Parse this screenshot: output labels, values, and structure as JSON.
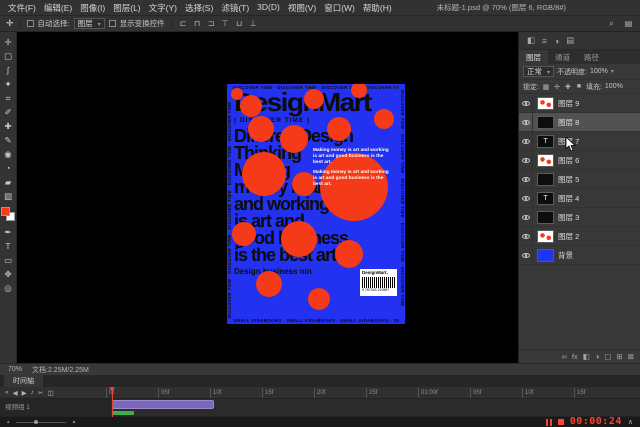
{
  "app": {
    "menu": [
      "文件(F)",
      "编辑(E)",
      "图像(I)",
      "图层(L)",
      "文字(Y)",
      "选择(S)",
      "滤镜(T)",
      "3D(D)",
      "视图(V)",
      "窗口(W)",
      "帮助(H)"
    ],
    "doc_title": "未标题-1.psd @ 70% (图层 6, RGB/8#)"
  },
  "options_bar": {
    "tool_glyph": "✛",
    "auto_select_label": "自动选择:",
    "auto_select_value": "图层",
    "show_transform_label": "显示变换控件",
    "align_icons": [
      {
        "name": "align-left-icon",
        "glyph": "⊏"
      },
      {
        "name": "align-center-horizontal-icon",
        "glyph": "⊓"
      },
      {
        "name": "align-right-icon",
        "glyph": "⊐"
      },
      {
        "name": "align-top-icon",
        "glyph": "⊤"
      },
      {
        "name": "align-middle-icon",
        "glyph": "⊔"
      },
      {
        "name": "align-bottom-icon",
        "glyph": "⊥"
      }
    ],
    "right_icons": [
      {
        "name": "search-icon",
        "glyph": "⌕"
      },
      {
        "name": "workspace-icon",
        "glyph": "▤"
      }
    ]
  },
  "toolbar": {
    "tools": [
      {
        "name": "move-tool",
        "glyph": "✛"
      },
      {
        "name": "marquee-tool",
        "glyph": "▢"
      },
      {
        "name": "lasso-tool",
        "glyph": "ʃ"
      },
      {
        "name": "magic-wand-tool",
        "glyph": "✦"
      },
      {
        "name": "crop-tool",
        "glyph": "⌗"
      },
      {
        "name": "eyedropper-tool",
        "glyph": "✐"
      },
      {
        "name": "healing-brush-tool",
        "glyph": "✚"
      },
      {
        "name": "brush-tool",
        "glyph": "✎"
      },
      {
        "name": "clone-stamp-tool",
        "glyph": "◉"
      },
      {
        "name": "history-brush-tool",
        "glyph": "◔"
      },
      {
        "name": "eraser-tool",
        "glyph": "▰"
      },
      {
        "name": "gradient-tool",
        "glyph": "▧"
      }
    ],
    "tools_lower": [
      {
        "name": "pen-tool",
        "glyph": "✒"
      },
      {
        "name": "type-tool",
        "glyph": "T"
      },
      {
        "name": "shape-tool",
        "glyph": "▭"
      },
      {
        "name": "hand-tool",
        "glyph": "✥"
      },
      {
        "name": "zoom-tool",
        "glyph": "◎"
      }
    ],
    "foreground_color": "#f43a18",
    "background_color": "#ffffff"
  },
  "poster": {
    "bg_color": "#2331f0",
    "circle_color": "#f43a18",
    "border_text_h": "DISCOVER TIME · DISCOVER TIME · DISCOVER TIME · DISCOVER TIME · DISCOVER TIME",
    "border_text_bottom": "SMALL KIDABOOKS · SMALL KIDABOOKS · SMALL KIDABOOKS · SMALL KIDABOOKS",
    "title": "DesignMart",
    "subtitle": "( DISCOVER TIME )",
    "lines": [
      "DifferentDesign",
      "Thinking",
      "Making",
      "money is art",
      "and working",
      "is art and",
      "good business",
      "is the best art"
    ],
    "small_line": "Design business nin",
    "white_paragraphs": [
      "Making money is art and working is art and good business is the best art.",
      "Making money is art and working is art and good business is the best art."
    ],
    "barcode_label": "DesignMart.",
    "barcode_number": "9 787543 210987",
    "circles": [
      [
        10,
        10,
        6
      ],
      [
        24,
        22,
        11
      ],
      [
        87,
        15,
        10
      ],
      [
        132,
        6,
        8
      ],
      [
        34,
        45,
        13
      ],
      [
        67,
        55,
        14
      ],
      [
        112,
        45,
        12
      ],
      [
        157,
        35,
        10
      ],
      [
        37,
        90,
        22
      ],
      [
        127,
        103,
        34
      ],
      [
        77,
        100,
        12
      ],
      [
        17,
        150,
        12
      ],
      [
        72,
        155,
        18
      ],
      [
        122,
        170,
        14
      ],
      [
        42,
        200,
        13
      ],
      [
        92,
        215,
        11
      ],
      [
        157,
        205,
        7
      ]
    ]
  },
  "right_dock": {
    "mini_icons": [
      {
        "name": "color-panel-icon",
        "glyph": "◧"
      },
      {
        "name": "properties-panel-icon",
        "glyph": "≡"
      },
      {
        "name": "adjustments-panel-icon",
        "glyph": "◑"
      },
      {
        "name": "libraries-panel-icon",
        "glyph": "▤"
      }
    ],
    "tabs": [
      "图层",
      "通道",
      "路径"
    ],
    "blend_mode": "正常",
    "opacity_label": "不透明度:",
    "opacity_value": "100%",
    "lock_label": "锁定:",
    "lock_icons": [
      {
        "name": "lock-transparency-icon",
        "glyph": "▦"
      },
      {
        "name": "lock-pixels-icon",
        "glyph": "✛"
      },
      {
        "name": "lock-position-icon",
        "glyph": "✚"
      },
      {
        "name": "lock-all-icon",
        "glyph": "■"
      }
    ],
    "fill_label": "填充:",
    "fill_value": "100%",
    "text_thumb_glyph": "T",
    "layers": [
      {
        "name": "图层 9",
        "thumb": "dots"
      },
      {
        "name": "图层 8",
        "thumb": "dark",
        "selected": true
      },
      {
        "name": "图层 7",
        "thumb": "text"
      },
      {
        "name": "图层 6",
        "thumb": "dots"
      },
      {
        "name": "图层 5",
        "thumb": "dark"
      },
      {
        "name": "图层 4",
        "thumb": "text"
      },
      {
        "name": "图层 3",
        "thumb": "dark"
      },
      {
        "name": "图层 2",
        "thumb": "dots"
      },
      {
        "name": "背景",
        "thumb": "blue"
      }
    ],
    "footer_icons": [
      {
        "name": "link-layers-icon",
        "glyph": "∞"
      },
      {
        "name": "layer-effects-icon",
        "glyph": "fx"
      },
      {
        "name": "layer-mask-icon",
        "glyph": "◧"
      },
      {
        "name": "adjustment-layer-icon",
        "glyph": "◑"
      },
      {
        "name": "layer-group-icon",
        "glyph": "▢"
      },
      {
        "name": "new-layer-icon",
        "glyph": "⊞"
      },
      {
        "name": "delete-layer-icon",
        "glyph": "⊠"
      }
    ]
  },
  "status_bar": {
    "zoom": "70%",
    "doc_info": "文档:2.25M/2.25M"
  },
  "timeline": {
    "tab": "时间轴",
    "transport": [
      {
        "name": "first-frame-button",
        "glyph": "«"
      },
      {
        "name": "previous-frame-button",
        "glyph": "◀"
      },
      {
        "name": "play-button",
        "glyph": "▶"
      },
      {
        "name": "audio-mute-button",
        "glyph": "♪"
      },
      {
        "name": "split-clip-button",
        "glyph": "✂"
      },
      {
        "name": "transition-button",
        "glyph": "◫"
      }
    ],
    "ruler": [
      "0f",
      "05f",
      "10f",
      "15f",
      "20f",
      "25f",
      "01:00f",
      "05f",
      "10f",
      "15f"
    ],
    "video_track_label": "视频组 1",
    "clip_color": "#7a68b8",
    "audio_clip_color": "#3fae4a"
  },
  "record_bar": {
    "timecode": "00:00:24"
  }
}
